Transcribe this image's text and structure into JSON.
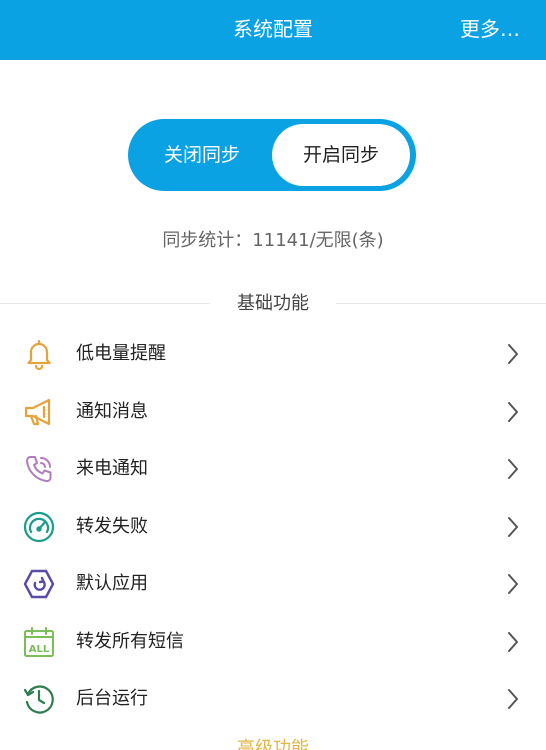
{
  "header": {
    "title": "系统配置",
    "more": "更多…"
  },
  "sync_toggle": {
    "off_label": "关闭同步",
    "on_label": "开启同步",
    "selected": "on"
  },
  "stats": {
    "text": "同步统计：11141/无限(条)"
  },
  "sections": {
    "basic": "基础功能",
    "advanced": "高级功能"
  },
  "colors": {
    "accent": "#0aa2e3"
  },
  "basic_items": [
    {
      "label": "低电量提醒",
      "icon": "bell-icon",
      "color": "#e6a33a"
    },
    {
      "label": "通知消息",
      "icon": "megaphone-icon",
      "color": "#e6a33a"
    },
    {
      "label": "来电通知",
      "icon": "phone-icon",
      "color": "#b07bbf"
    },
    {
      "label": "转发失败",
      "icon": "gauge-icon",
      "color": "#1a9c8c"
    },
    {
      "label": "默认应用",
      "icon": "app-hexagon-icon",
      "color": "#5a4aa8"
    },
    {
      "label": "转发所有短信",
      "icon": "all-calendar-icon",
      "color": "#7cbd5a"
    },
    {
      "label": "后台运行",
      "icon": "clock-icon",
      "color": "#2e7d4f"
    }
  ]
}
